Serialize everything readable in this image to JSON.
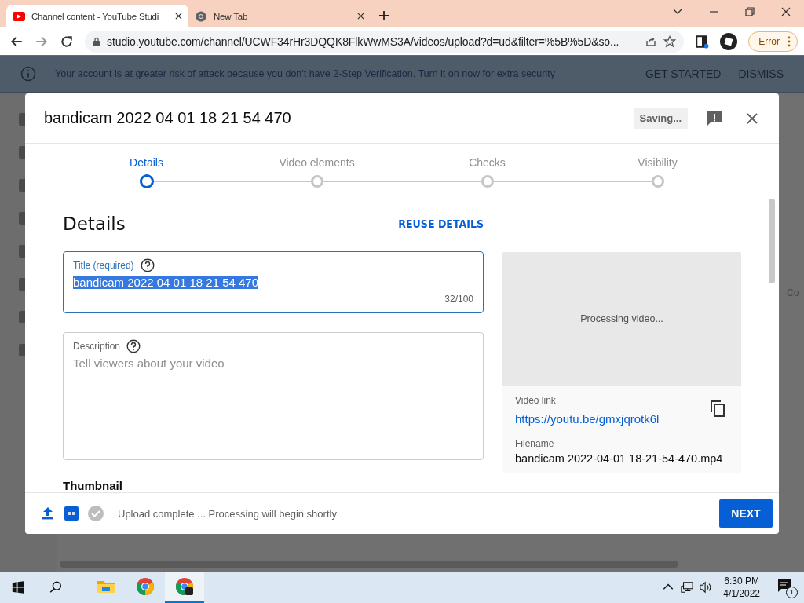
{
  "browser": {
    "tabs": [
      {
        "title": "Channel content - YouTube Studi",
        "selected": true
      },
      {
        "title": "New Tab",
        "selected": false
      }
    ],
    "address": "studio.youtube.com/channel/UCWF34rHr3DQQK8FlkWwMS3A/videos/upload?d=ud&filter=%5B%5D&so...",
    "profile_button": "Error"
  },
  "banner": {
    "message": "Your account is at greater risk of attack because you don't have 2-Step Verification. Turn it on now for extra security",
    "actions": [
      "GET STARTED",
      "DISMISS"
    ]
  },
  "background": {
    "column_text": "Co"
  },
  "dialog": {
    "title": "bandicam 2022 04 01 18 21 54 470",
    "status_chip": "Saving...",
    "steps": [
      {
        "label": "Details",
        "selected": true
      },
      {
        "label": "Video elements",
        "selected": false
      },
      {
        "label": "Checks",
        "selected": false
      },
      {
        "label": "Visibility",
        "selected": false
      }
    ],
    "section_title": "Details",
    "reuse_link": "REUSE DETAILS",
    "title_field": {
      "label": "Title (required)",
      "value": "bandicam 2022 04 01 18 21 54 470",
      "value_selected": true,
      "counter": "32/100",
      "focused": true
    },
    "description_field": {
      "label": "Description",
      "placeholder": "Tell viewers about your video"
    },
    "thumbnail_heading": "Thumbnail",
    "preview": {
      "status": "Processing video...",
      "link_label": "Video link",
      "link": "https://youtu.be/gmxjqrotk6l",
      "filename_label": "Filename",
      "filename": "bandicam 2022-04-01 18-21-54-470.mp4"
    },
    "footer": {
      "status": "Upload complete ... Processing will begin shortly",
      "next": "NEXT"
    }
  },
  "taskbar": {
    "apps": [
      {
        "kind": "explorer",
        "selected": false
      },
      {
        "kind": "chrome",
        "selected": false
      },
      {
        "kind": "chrome",
        "selected": true
      }
    ],
    "time": "6:30 PM",
    "date": "4/1/2022",
    "notifications": "1"
  }
}
